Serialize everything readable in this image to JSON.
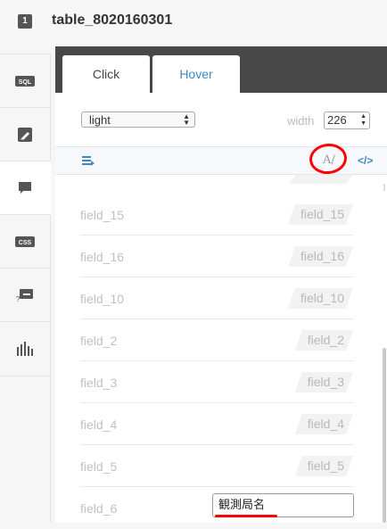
{
  "header": {
    "layer_number": "1",
    "table_name": "table_8020160301"
  },
  "sidebar": {
    "items": [
      {
        "name": "sql",
        "icon": "sql-icon",
        "label": "SQL"
      },
      {
        "name": "wizard",
        "icon": "brush-icon"
      },
      {
        "name": "infowindow",
        "icon": "speech-bubble-icon",
        "active": true
      },
      {
        "name": "css",
        "icon": "css-icon",
        "label": "CSS"
      },
      {
        "name": "legend",
        "icon": "legend-icon"
      },
      {
        "name": "chart",
        "icon": "bar-chart-icon"
      }
    ]
  },
  "tabs": {
    "click": "Click",
    "hover": "Hover"
  },
  "controls": {
    "theme_value": "light",
    "width_label": "width",
    "width_value": "226"
  },
  "toolbar": {
    "font_label": "A/",
    "code_label": "</>"
  },
  "fields": [
    {
      "name": "field_15",
      "tag": "field_15"
    },
    {
      "name": "field_16",
      "tag": "field_16"
    },
    {
      "name": "field_10",
      "tag": "field_10"
    },
    {
      "name": "field_2",
      "tag": "field_2"
    },
    {
      "name": "field_3",
      "tag": "field_3"
    },
    {
      "name": "field_4",
      "tag": "field_4"
    },
    {
      "name": "field_5",
      "tag": "field_5"
    },
    {
      "name": "field_6",
      "tag": ""
    }
  ],
  "title_input_value": "観測局名",
  "colors": {
    "accent": "#3a8bc4",
    "annotation": "#ff0000",
    "dark": "#484848"
  }
}
